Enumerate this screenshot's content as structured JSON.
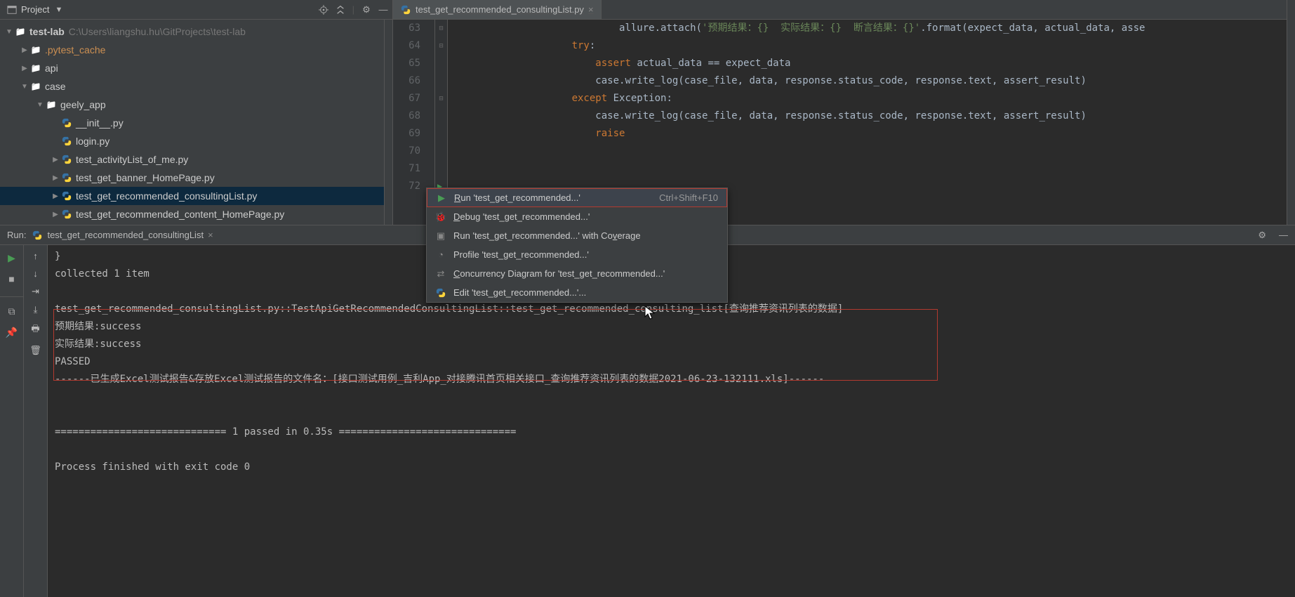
{
  "project_panel": {
    "title": "Project",
    "root": {
      "name": "test-lab",
      "path": "C:\\Users\\liangshu.hu\\GitProjects\\test-lab"
    },
    "nodes": [
      {
        "indent": 1,
        "arrow": "collapsed",
        "icon": "folder",
        "label": ".pytest_cache",
        "class": "orange"
      },
      {
        "indent": 1,
        "arrow": "collapsed",
        "icon": "folder",
        "label": "api"
      },
      {
        "indent": 1,
        "arrow": "expanded",
        "icon": "folder",
        "label": "case"
      },
      {
        "indent": 2,
        "arrow": "expanded",
        "icon": "folder",
        "label": "geely_app"
      },
      {
        "indent": 3,
        "arrow": "",
        "icon": "py",
        "label": "__init__.py"
      },
      {
        "indent": 3,
        "arrow": "",
        "icon": "py",
        "label": "login.py"
      },
      {
        "indent": 3,
        "arrow": "collapsed",
        "icon": "py",
        "label": "test_activityList_of_me.py"
      },
      {
        "indent": 3,
        "arrow": "collapsed",
        "icon": "py",
        "label": "test_get_banner_HomePage.py"
      },
      {
        "indent": 3,
        "arrow": "collapsed",
        "icon": "py",
        "label": "test_get_recommended_consultingList.py",
        "selected": true
      },
      {
        "indent": 3,
        "arrow": "collapsed",
        "icon": "py",
        "label": "test_get_recommended_content_HomePage.py"
      }
    ]
  },
  "editor": {
    "tab_name": "test_get_recommended_consultingList.py",
    "lines": [
      {
        "n": 63,
        "tokens": [
          [
            "    ",
            "id"
          ],
          [
            "allure.attach(",
            "id"
          ],
          [
            "'预期结果：{}  实际结果：{}  断言结果：{}'",
            "str"
          ],
          [
            ".format(expect_data, actual_data, asse",
            "id"
          ]
        ]
      },
      {
        "n": 64,
        "tokens": [
          [
            "try",
            "kw"
          ],
          [
            ":",
            "id"
          ]
        ]
      },
      {
        "n": 65,
        "tokens": [
          [
            "    ",
            "id"
          ],
          [
            "assert ",
            "kw"
          ],
          [
            "actual_data == expect_data",
            "id"
          ]
        ]
      },
      {
        "n": 66,
        "tokens": [
          [
            "    ",
            "id"
          ],
          [
            "case.write_log(case_file, data, response.status_code, response.text, assert_result)",
            "id"
          ]
        ]
      },
      {
        "n": 67,
        "tokens": [
          [
            "except ",
            "kw"
          ],
          [
            "Exception",
            "id"
          ],
          [
            ":",
            "id"
          ]
        ]
      },
      {
        "n": 68,
        "tokens": [
          [
            "    ",
            "id"
          ],
          [
            "case.write_log(case_file, data, response.status_code, response.text, assert_result)",
            "id"
          ]
        ]
      },
      {
        "n": 69,
        "tokens": [
          [
            "    ",
            "id"
          ],
          [
            "raise",
            "kw"
          ]
        ]
      },
      {
        "n": 70,
        "tokens": []
      },
      {
        "n": 71,
        "tokens": []
      },
      {
        "n": 72,
        "tokens": []
      }
    ]
  },
  "context_menu": {
    "items": [
      {
        "icon": "run",
        "label_pre": "",
        "key": "R",
        "label_post": "un 'test_get_recommended...'",
        "shortcut": "Ctrl+Shift+F10",
        "hl": true
      },
      {
        "icon": "debug",
        "label_pre": "",
        "key": "D",
        "label_post": "ebug 'test_get_recommended...'"
      },
      {
        "icon": "coverage",
        "label_pre": "Run 'test_get_recommended...' with Co",
        "key": "v",
        "label_post": "erage"
      },
      {
        "icon": "profile",
        "label_pre": "Profile 'test_get_recommended...'"
      },
      {
        "icon": "concur",
        "label_pre": "",
        "key": "C",
        "label_post": "oncurrency Diagram for 'test_get_recommended...'"
      },
      {
        "icon": "python",
        "label_pre": "Edit 'test_get_recommended...'..."
      }
    ]
  },
  "run": {
    "label": "Run:",
    "tab": "test_get_recommended_consultingList",
    "console_lines": [
      "}",
      "collected 1 item",
      "",
      "test_get_recommended_consultingList.py::TestApiGetRecommendedConsultingList::test_get_recommended_consulting_list[查询推荐资讯列表的数据]",
      "预期结果:success",
      "实际结果:success",
      "PASSED",
      "------已生成Excel测试报告&存放Excel测试报告的文件名：[接口测试用例_吉利App_对接腾讯首页相关接口_查询推荐资讯列表的数据2021-06-23-132111.xls]------",
      "",
      "",
      "============================= 1 passed in 0.35s ==============================",
      "",
      "Process finished with exit code 0"
    ]
  }
}
